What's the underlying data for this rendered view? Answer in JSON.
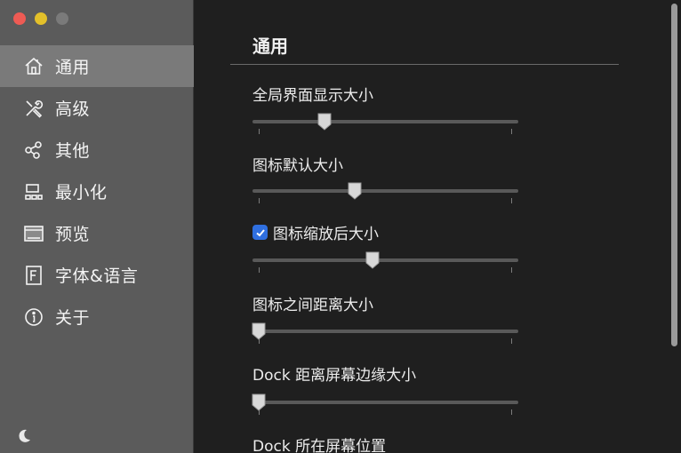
{
  "window": {
    "traffic_lights": {
      "close": "#ee5b54",
      "minimize": "#e3c02a",
      "zoom": "#7a7a7a"
    }
  },
  "sidebar": {
    "items": [
      {
        "label": "通用",
        "icon": "home-icon",
        "active": true
      },
      {
        "label": "高级",
        "icon": "tools-icon",
        "active": false
      },
      {
        "label": "其他",
        "icon": "share-icon",
        "active": false
      },
      {
        "label": "最小化",
        "icon": "minimize-icon",
        "active": false
      },
      {
        "label": "预览",
        "icon": "preview-icon",
        "active": false
      },
      {
        "label": "字体&语言",
        "icon": "font-icon",
        "active": false
      },
      {
        "label": "关于",
        "icon": "info-icon",
        "active": false
      }
    ],
    "bottom_icon": "moon-icon"
  },
  "main": {
    "title": "通用",
    "settings": [
      {
        "label": "全局界面显示大小",
        "value": 0.26
      },
      {
        "label": "图标默认大小",
        "value": 0.38
      },
      {
        "label": "图标缩放后大小",
        "value": 0.45,
        "checked": true
      },
      {
        "label": "图标之间距离大小",
        "value": 0.0
      },
      {
        "label": "Dock 距离屏幕边缘大小",
        "value": 0.0
      },
      {
        "label": "Dock 所在屏幕位置"
      }
    ]
  },
  "colors": {
    "sidebar_bg": "#5b5b5b",
    "sidebar_active": "#7a7a7a",
    "main_bg": "#1f1f1f",
    "accent": "#2f6fe0"
  }
}
